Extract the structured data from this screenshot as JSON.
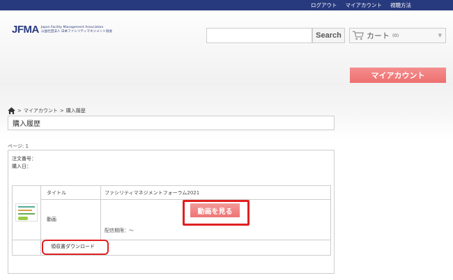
{
  "topnav": {
    "logout": "ログアウト",
    "myaccount": "マイアカウント",
    "howto": "視聴方法"
  },
  "logo": {
    "mark": "JFMA",
    "english": "Japan Facility Management Association",
    "japanese": "公益社団法人 日本ファシリティマネジメント協会"
  },
  "search": {
    "placeholder": "",
    "button_label": "Search"
  },
  "cart": {
    "label": "カート",
    "count": "(0)"
  },
  "sidebar": {
    "myaccount_button": "マイアカウント"
  },
  "breadcrumb": {
    "sep1": ">",
    "myaccount": "マイアカウント",
    "sep2": ">",
    "current": "購入履歴"
  },
  "page": {
    "title": "購入履歴",
    "page_label": "ページ: 1"
  },
  "order": {
    "order_number_label": "注文番号：",
    "purchase_date_label": "購入日：",
    "item": {
      "title_label": "タイトル",
      "title_value": "ファシリティマネジメントフォーラム2021",
      "video_label": "動画",
      "video_button": "動画を見る",
      "period": "配信期限：～",
      "receipt_link": "領収書ダウンロード"
    }
  },
  "colors": {
    "navbar": "#283a7e",
    "accent_pink": "#ee7474",
    "highlight_red": "#e02020"
  }
}
